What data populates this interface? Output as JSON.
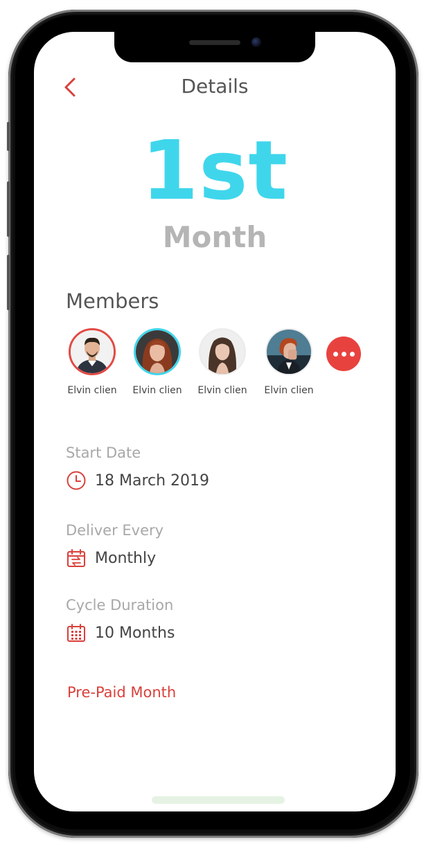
{
  "header": {
    "back_icon": "chevron-left-icon",
    "title": "Details"
  },
  "hero": {
    "ordinal": "1st",
    "unit": "Month"
  },
  "members": {
    "heading": "Members",
    "items": [
      {
        "name": "Elvin clien",
        "ring_color": "#e34a45"
      },
      {
        "name": "Elvin clien",
        "ring_color": "#3fd6ec"
      },
      {
        "name": "Elvin clien",
        "ring_color": "#ececec"
      },
      {
        "name": "Elvin clien",
        "ring_color": "#ececec"
      }
    ],
    "more_icon": "more-dots-icon"
  },
  "details": {
    "start_date": {
      "label": "Start Date",
      "value": "18 March 2019",
      "icon": "clock-icon"
    },
    "deliver_every": {
      "label": "Deliver Every",
      "value": "Monthly",
      "icon": "calendar-repeat-icon"
    },
    "cycle_duration": {
      "label": "Cycle Duration",
      "value": "10 Months",
      "icon": "calendar-grid-icon"
    }
  },
  "prepaid_link": "Pre-Paid Month",
  "colors": {
    "accent_red": "#e34a45",
    "ordinal_cyan": "#3fd6ec",
    "muted_gray": "#a8a8a8"
  }
}
